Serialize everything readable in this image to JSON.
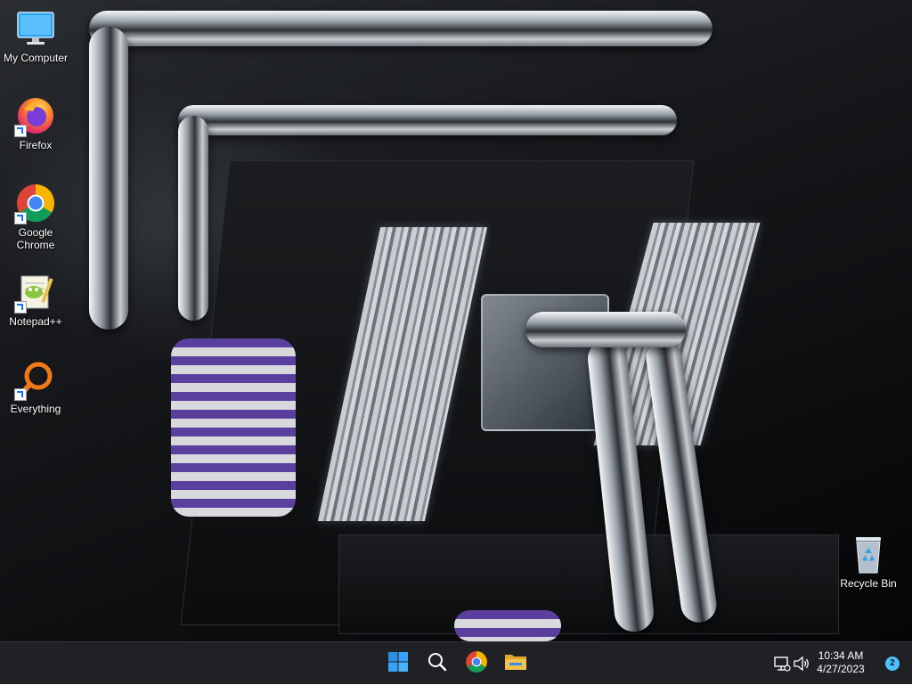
{
  "desktop": {
    "wallpaper": "custom water-cooled PC build wallpaper",
    "icons": [
      {
        "label": "My Computer",
        "icon": "monitor-icon",
        "shortcut": false
      },
      {
        "label": "Firefox",
        "icon": "firefox-icon",
        "shortcut": true
      },
      {
        "label": "Google\nChrome",
        "icon": "chrome-icon",
        "shortcut": true
      },
      {
        "label": "Notepad++",
        "icon": "notepadpp-icon",
        "shortcut": true
      },
      {
        "label": "Everything",
        "icon": "everything-icon",
        "shortcut": true
      },
      {
        "label": "Recycle Bin",
        "icon": "recycle-bin-icon",
        "shortcut": false
      }
    ]
  },
  "taskbar": {
    "pinned": [
      {
        "name": "Start",
        "icon": "windows-start-icon"
      },
      {
        "name": "Search",
        "icon": "search-icon"
      },
      {
        "name": "Google Chrome",
        "icon": "chrome-icon"
      },
      {
        "name": "File Explorer",
        "icon": "folder-icon"
      }
    ],
    "tray": {
      "network_icon": "network-icon",
      "volume_icon": "volume-icon",
      "time": "10:34 AM",
      "date": "4/27/2023",
      "notification_count": "2"
    }
  },
  "colors": {
    "taskbar_bg": "#1f2124",
    "accent": "#4cc2ff",
    "start_blue": "#2b8fe6",
    "folder_yellow": "#f2c14e"
  }
}
